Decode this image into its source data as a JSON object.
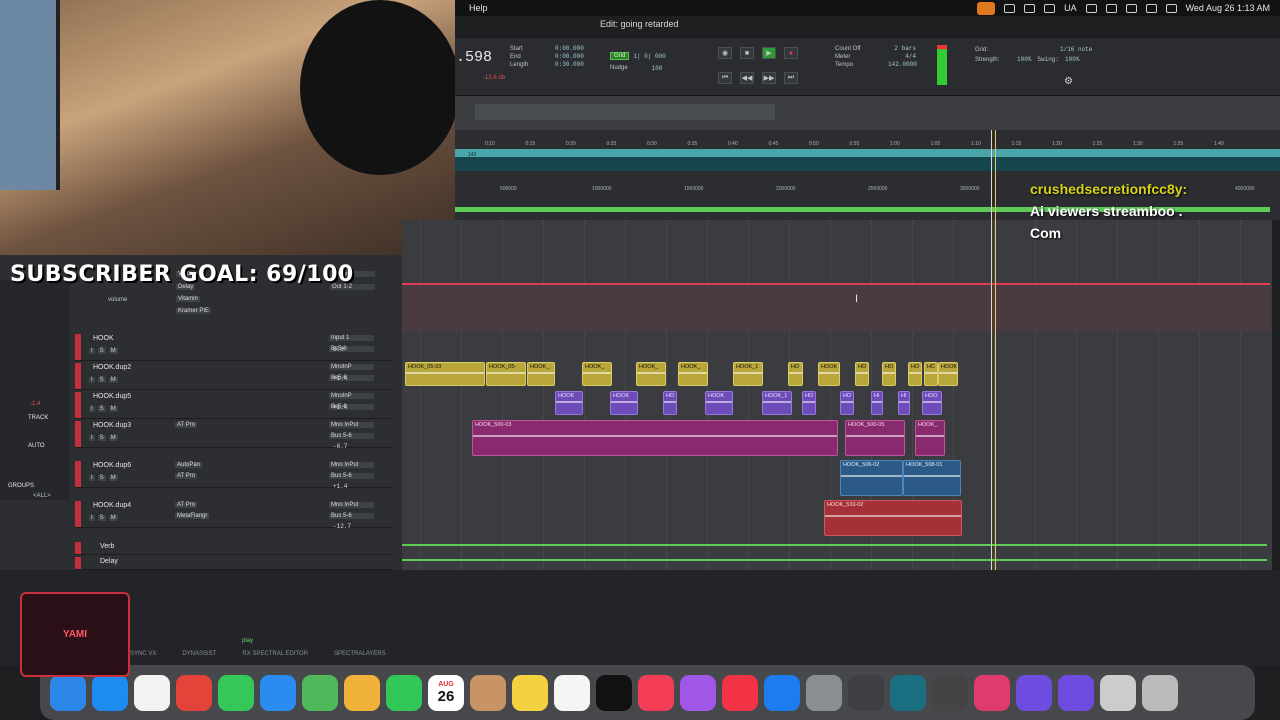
{
  "menubar": {
    "help": "Help",
    "datetime": "Wed Aug 26  1:13 AM",
    "locale": "UA"
  },
  "edit_title": "Edit: going retarded",
  "counters": {
    "main": ".598",
    "labels": [
      "Start",
      "End",
      "Length"
    ],
    "values": [
      "0:00.000",
      "0:00.000",
      "0:30.000"
    ],
    "level": "-13.6 db",
    "grid_label": "Grid",
    "grid_value": "1| 0| 000",
    "nudge_label": "Nudge",
    "nudge_value": "100",
    "count_off": "Count Off",
    "meter": "Meter",
    "tempo": "Tempo",
    "bars": "2 bars",
    "meter_val": "4/4",
    "tempo_val": "142.0000",
    "grid2": "Grid:",
    "grid_note": "1/16 note",
    "strength": "Strength:",
    "strength_val": "100%",
    "swing": "Swing:",
    "swing_val": "100%"
  },
  "ruler_ticks": [
    "0:10",
    "0:15",
    "0:20",
    "0:25",
    "0:30",
    "0:35",
    "0:40",
    "0:45",
    "0:50",
    "0:55",
    "1:00",
    "1:05",
    "1:10",
    "1:15",
    "1:20",
    "1:25",
    "1:30",
    "1:35",
    "1:40"
  ],
  "sample_ticks": [
    "500000",
    "1000000",
    "1500000",
    "2000000",
    "2500000",
    "3000000",
    "4000000"
  ],
  "tempo_marker": "142",
  "overlay": {
    "line1": "crushedsecretionfcc8y:",
    "line2": "Ai viewers streamboo .",
    "line3": "Com"
  },
  "subscriber_goal": "SUBSCRIBER GOAL: 69/100",
  "mixer": {
    "inserts_top": [
      "Verb",
      "Delay",
      "Vitamin",
      "Kramer PIE"
    ],
    "bus_top": [
      "Bus 5-6",
      "Out 1-2"
    ],
    "vol_label": "volume",
    "tracks": [
      {
        "name": "HOOK",
        "io_in": "Input 1",
        "io_out": "Bs5-6",
        "vol": "0.0",
        "inserts": []
      },
      {
        "name": "HOOK.dup2",
        "io_in": "MnoInP",
        "io_out": "Bs5-6",
        "vol": "+1.4",
        "inserts": []
      },
      {
        "name": "HOOK.dup5",
        "io_in": "MnoInP",
        "io_out": "Bs5-6",
        "vol": "+1.4",
        "inserts": []
      },
      {
        "name": "HOOK.dup3",
        "io_in": "Mno InPut",
        "io_out": "Bus 5-6",
        "vol": "-6.7",
        "inserts": [
          "AT Pro"
        ]
      },
      {
        "name": "HOOK.dup6",
        "io_in": "Mno InPut",
        "io_out": "Bus 5-6",
        "vol": "+1.4",
        "inserts": [
          "AutoPan",
          "AT Pro"
        ]
      },
      {
        "name": "HOOK.dup4",
        "io_in": "Mno InPut",
        "io_out": "Bus 5-6",
        "vol": "-12.7",
        "inserts": [
          "AT Pro",
          "MetaFlangr"
        ]
      },
      {
        "name": "Verb",
        "io_in": "",
        "io_out": "",
        "vol": "",
        "inserts": []
      },
      {
        "name": "Delay",
        "io_in": "",
        "io_out": "",
        "vol": "",
        "inserts": []
      }
    ],
    "side_labels": [
      "TRACK",
      "AUTO",
      "GROUPS",
      "<ALL>"
    ],
    "side_value": "-1.4"
  },
  "clips": {
    "hook": [
      "HOOK_05-03",
      "HOOK_05-",
      "HOOK_",
      "HOOK_",
      "HOOK_",
      "HOOK_",
      "HOOK_1",
      "HO",
      "HOOK",
      "HO",
      "HO",
      "HO",
      "HC",
      "HOOK"
    ],
    "dup5": [
      "HOOK",
      "HOOK",
      "HO",
      "HOOK",
      "HOOK_1",
      "HO",
      "HO",
      "HI",
      "HI",
      "HOO"
    ],
    "dup3": [
      "HOOK_500-03",
      "HOOK_500-05",
      "HOOK_"
    ],
    "dup6": [
      "HOOK_506-02",
      "HOOK_508-01"
    ],
    "dup4": [
      "HOOK_510-02"
    ],
    "gain": "0 dB"
  },
  "plugins": [
    "SYNC VX",
    "DYNASSIST",
    "RX SPECTRAL EDITOR",
    "SPECTRALAYERS"
  ],
  "play_label": "play",
  "dock": {
    "apps": [
      "Finder",
      "Safari",
      "Reminders",
      "Chrome",
      "Messages",
      "Mail",
      "Maps",
      "Photos",
      "FaceTime",
      "Calendar",
      "Contacts",
      "Notes",
      "Freeform",
      "TV",
      "Music",
      "Podcasts",
      "News",
      "App Store",
      "Settings",
      "Pro Tools",
      "Waves",
      "Logic",
      "Creative Cloud",
      "Pro Tools 2",
      "Pro Tools 3",
      "Music Folder",
      "Trash"
    ],
    "calendar_month": "AUG",
    "calendar_day": "26"
  },
  "logo_text": "YAMI"
}
